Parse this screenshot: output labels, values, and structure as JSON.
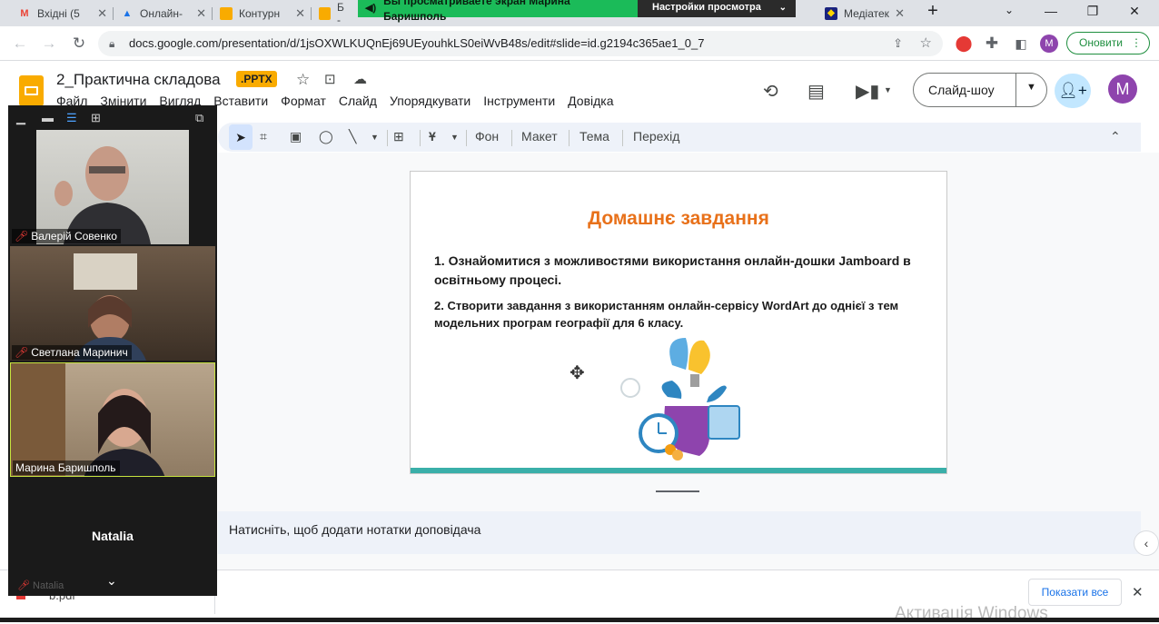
{
  "browser": {
    "tabs": [
      {
        "label": "Вхідні (5",
        "icon": "gmail-icon"
      },
      {
        "label": "Онлайн-",
        "icon": "google-drive-icon"
      },
      {
        "label": "Контурн",
        "icon": "slides-icon"
      },
      {
        "label": "Б -",
        "icon": "slides-icon"
      },
      {
        "label": "Медіатек",
        "icon": "mediateka-icon"
      }
    ],
    "new_tab": "+",
    "url": "docs.google.com/presentation/d/1jsOXWLKUQnEj69UEyouhkLS0eiWvB48s/edit#slide=id.g2194c365ae1_0_7",
    "update_button": "Оновити",
    "profile_letter": "M"
  },
  "share_banner": {
    "message": "Вы просматриваете экран Марина Баришполь",
    "settings": "Настройки просмотра"
  },
  "slides_app": {
    "doc_title": "2_Практична складова",
    "file_badge": ".PPTX",
    "menu": [
      "Файл",
      "Змінити",
      "Вигляд",
      "Вставити",
      "Формат",
      "Слайд",
      "Упорядкувати",
      "Інструменти",
      "Довідка"
    ],
    "slideshow_button": "Слайд-шоу",
    "avatar_letter": "M",
    "toolbar": {
      "background": "Фон",
      "layout": "Макет",
      "theme": "Тема",
      "transition": "Перехід"
    }
  },
  "slide": {
    "title": "Домашнє завдання",
    "item1": "1. Ознайомитися з можливостями використання онлайн-дошки Jamboard в освітньому процесі.",
    "item2": "2. Створити завдання з використанням онлайн-сервісу WordArt  до однієї з тем модельних програм географії для 6 класу."
  },
  "notes_placeholder": "Натисніть, щоб додати нотатки доповідача",
  "downloads": {
    "show_all": "Показати все",
    "partial_item": "b.pdf"
  },
  "watermark": "Активація Windows",
  "video_panel": {
    "participants": [
      {
        "name": "Валерій Совенко",
        "muted": true
      },
      {
        "name": "Светлана Маринич",
        "muted": true
      },
      {
        "name": "Марина Баришполь",
        "muted": false
      }
    ],
    "self_name": "Natalia",
    "self_label": "Natalia"
  },
  "colors": {
    "title_orange": "#e8711a",
    "accent_teal": "#3aafa9",
    "banner_green": "#1bbb59",
    "pptx_badge": "#f9ab00"
  }
}
